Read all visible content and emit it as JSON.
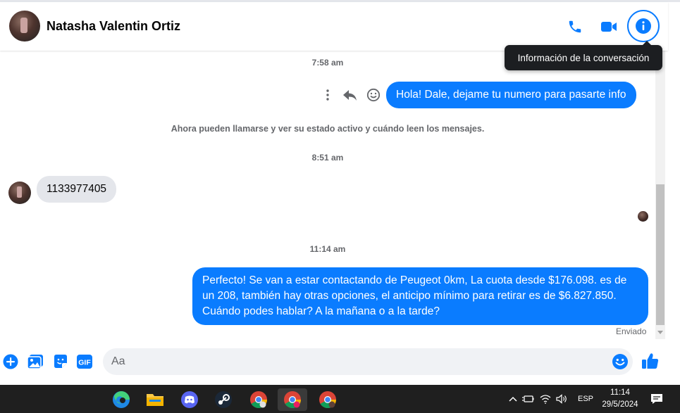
{
  "header": {
    "contact_name": "Natasha Valentin Ortiz",
    "tooltip": "Información de la conversación",
    "accent_color": "#0a7cff"
  },
  "messages": {
    "time_1": "7:58 am",
    "out_1": "Hola! Dale, dejame tu numero para pasarte info",
    "system_notice": "Ahora pueden llamarse y ver su estado activo y cuándo leen los mensajes.",
    "time_2": "8:51 am",
    "in_1": "1133977405",
    "time_3": "11:14 am",
    "out_2": "Perfecto!  Se van a estar contactando de Peugeot 0km, La cuota desde $176.098. es de un 208, también hay otras opciones, el anticipo mínimo para retirar es de $6.827.850. Cuándo podes hablar? A la mañana o a la tarde?",
    "status": "Enviado"
  },
  "composer": {
    "placeholder": "Aa",
    "gif_label": "GIF"
  },
  "taskbar": {
    "language": "ESP",
    "time": "11:14",
    "date": "29/5/2024"
  }
}
